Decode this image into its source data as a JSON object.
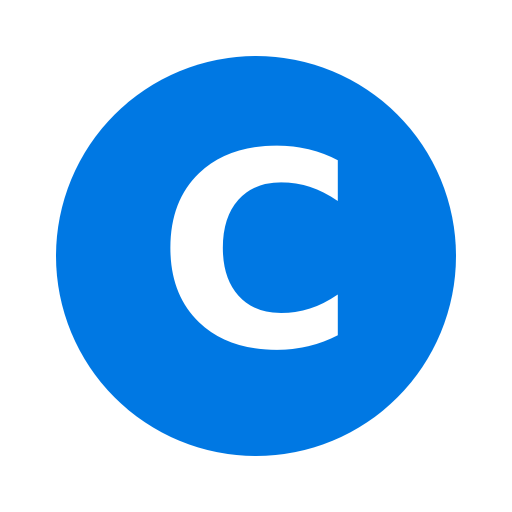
{
  "icon": {
    "name": "letter-c-icon",
    "letter": "C",
    "background_color": "#0078E3",
    "letter_color": "#FFFFFF"
  }
}
